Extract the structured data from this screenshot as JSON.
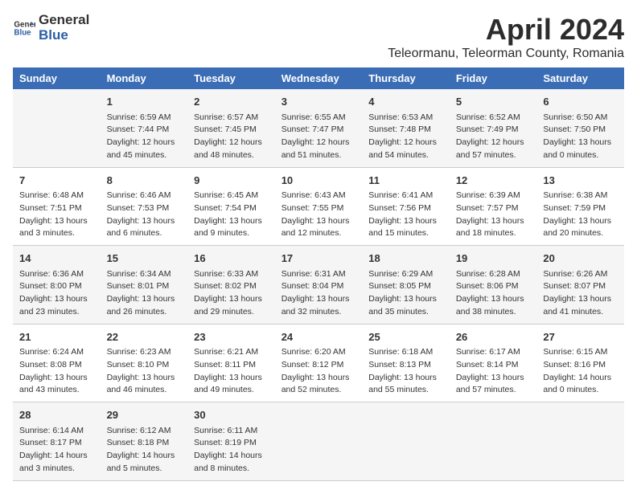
{
  "header": {
    "logo_general": "General",
    "logo_blue": "Blue",
    "title": "April 2024",
    "subtitle": "Teleormanu, Teleorman County, Romania"
  },
  "calendar": {
    "days_of_week": [
      "Sunday",
      "Monday",
      "Tuesday",
      "Wednesday",
      "Thursday",
      "Friday",
      "Saturday"
    ],
    "weeks": [
      [
        {
          "day": "",
          "info": ""
        },
        {
          "day": "1",
          "info": "Sunrise: 6:59 AM\nSunset: 7:44 PM\nDaylight: 12 hours\nand 45 minutes."
        },
        {
          "day": "2",
          "info": "Sunrise: 6:57 AM\nSunset: 7:45 PM\nDaylight: 12 hours\nand 48 minutes."
        },
        {
          "day": "3",
          "info": "Sunrise: 6:55 AM\nSunset: 7:47 PM\nDaylight: 12 hours\nand 51 minutes."
        },
        {
          "day": "4",
          "info": "Sunrise: 6:53 AM\nSunset: 7:48 PM\nDaylight: 12 hours\nand 54 minutes."
        },
        {
          "day": "5",
          "info": "Sunrise: 6:52 AM\nSunset: 7:49 PM\nDaylight: 12 hours\nand 57 minutes."
        },
        {
          "day": "6",
          "info": "Sunrise: 6:50 AM\nSunset: 7:50 PM\nDaylight: 13 hours\nand 0 minutes."
        }
      ],
      [
        {
          "day": "7",
          "info": "Sunrise: 6:48 AM\nSunset: 7:51 PM\nDaylight: 13 hours\nand 3 minutes."
        },
        {
          "day": "8",
          "info": "Sunrise: 6:46 AM\nSunset: 7:53 PM\nDaylight: 13 hours\nand 6 minutes."
        },
        {
          "day": "9",
          "info": "Sunrise: 6:45 AM\nSunset: 7:54 PM\nDaylight: 13 hours\nand 9 minutes."
        },
        {
          "day": "10",
          "info": "Sunrise: 6:43 AM\nSunset: 7:55 PM\nDaylight: 13 hours\nand 12 minutes."
        },
        {
          "day": "11",
          "info": "Sunrise: 6:41 AM\nSunset: 7:56 PM\nDaylight: 13 hours\nand 15 minutes."
        },
        {
          "day": "12",
          "info": "Sunrise: 6:39 AM\nSunset: 7:57 PM\nDaylight: 13 hours\nand 18 minutes."
        },
        {
          "day": "13",
          "info": "Sunrise: 6:38 AM\nSunset: 7:59 PM\nDaylight: 13 hours\nand 20 minutes."
        }
      ],
      [
        {
          "day": "14",
          "info": "Sunrise: 6:36 AM\nSunset: 8:00 PM\nDaylight: 13 hours\nand 23 minutes."
        },
        {
          "day": "15",
          "info": "Sunrise: 6:34 AM\nSunset: 8:01 PM\nDaylight: 13 hours\nand 26 minutes."
        },
        {
          "day": "16",
          "info": "Sunrise: 6:33 AM\nSunset: 8:02 PM\nDaylight: 13 hours\nand 29 minutes."
        },
        {
          "day": "17",
          "info": "Sunrise: 6:31 AM\nSunset: 8:04 PM\nDaylight: 13 hours\nand 32 minutes."
        },
        {
          "day": "18",
          "info": "Sunrise: 6:29 AM\nSunset: 8:05 PM\nDaylight: 13 hours\nand 35 minutes."
        },
        {
          "day": "19",
          "info": "Sunrise: 6:28 AM\nSunset: 8:06 PM\nDaylight: 13 hours\nand 38 minutes."
        },
        {
          "day": "20",
          "info": "Sunrise: 6:26 AM\nSunset: 8:07 PM\nDaylight: 13 hours\nand 41 minutes."
        }
      ],
      [
        {
          "day": "21",
          "info": "Sunrise: 6:24 AM\nSunset: 8:08 PM\nDaylight: 13 hours\nand 43 minutes."
        },
        {
          "day": "22",
          "info": "Sunrise: 6:23 AM\nSunset: 8:10 PM\nDaylight: 13 hours\nand 46 minutes."
        },
        {
          "day": "23",
          "info": "Sunrise: 6:21 AM\nSunset: 8:11 PM\nDaylight: 13 hours\nand 49 minutes."
        },
        {
          "day": "24",
          "info": "Sunrise: 6:20 AM\nSunset: 8:12 PM\nDaylight: 13 hours\nand 52 minutes."
        },
        {
          "day": "25",
          "info": "Sunrise: 6:18 AM\nSunset: 8:13 PM\nDaylight: 13 hours\nand 55 minutes."
        },
        {
          "day": "26",
          "info": "Sunrise: 6:17 AM\nSunset: 8:14 PM\nDaylight: 13 hours\nand 57 minutes."
        },
        {
          "day": "27",
          "info": "Sunrise: 6:15 AM\nSunset: 8:16 PM\nDaylight: 14 hours\nand 0 minutes."
        }
      ],
      [
        {
          "day": "28",
          "info": "Sunrise: 6:14 AM\nSunset: 8:17 PM\nDaylight: 14 hours\nand 3 minutes."
        },
        {
          "day": "29",
          "info": "Sunrise: 6:12 AM\nSunset: 8:18 PM\nDaylight: 14 hours\nand 5 minutes."
        },
        {
          "day": "30",
          "info": "Sunrise: 6:11 AM\nSunset: 8:19 PM\nDaylight: 14 hours\nand 8 minutes."
        },
        {
          "day": "",
          "info": ""
        },
        {
          "day": "",
          "info": ""
        },
        {
          "day": "",
          "info": ""
        },
        {
          "day": "",
          "info": ""
        }
      ]
    ]
  }
}
